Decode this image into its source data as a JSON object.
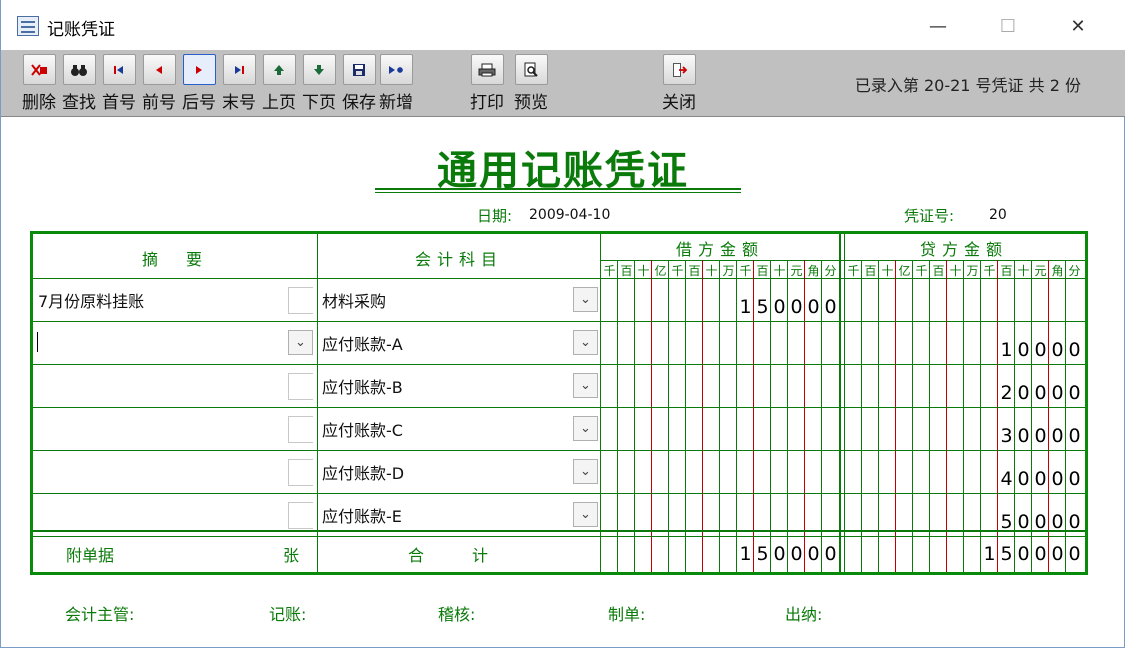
{
  "window": {
    "title": "记账凭证",
    "minimize": "—",
    "maximize": "☐",
    "close": "✕"
  },
  "toolbar": {
    "buttons": [
      {
        "label": "删除",
        "icon": "delete-icon"
      },
      {
        "label": "查找",
        "icon": "binoculars-icon"
      },
      {
        "label": "首号",
        "icon": "first-icon"
      },
      {
        "label": "前号",
        "icon": "prev-icon"
      },
      {
        "label": "后号",
        "icon": "next-icon"
      },
      {
        "label": "末号",
        "icon": "last-icon"
      },
      {
        "label": "上页",
        "icon": "up-icon"
      },
      {
        "label": "下页",
        "icon": "down-icon"
      },
      {
        "label": "保存",
        "icon": "save-icon"
      },
      {
        "label": "新增",
        "icon": "new-icon"
      },
      {
        "label": "打印",
        "icon": "printer-icon"
      },
      {
        "label": "预览",
        "icon": "preview-icon"
      },
      {
        "label": "关闭",
        "icon": "exit-icon"
      }
    ],
    "status": "已录入第 20-21 号凭证 共 2 份"
  },
  "voucher": {
    "title": "通用记账凭证",
    "date_label": "日期:",
    "date": "2009-04-10",
    "number_label": "凭证号:",
    "number": "20",
    "headers": {
      "summary": "摘　要",
      "account": "会计科目",
      "debit": "借方金额",
      "credit": "贷方金额",
      "units": [
        "千",
        "百",
        "十",
        "亿",
        "千",
        "百",
        "十",
        "万",
        "千",
        "百",
        "十",
        "元",
        "角",
        "分"
      ]
    },
    "rows": [
      {
        "summary": "7月份原料挂账",
        "account": "材料采购",
        "debit": "150000",
        "credit": ""
      },
      {
        "summary": "",
        "account": "应付账款-A",
        "debit": "",
        "credit": "10000"
      },
      {
        "summary": "",
        "account": "应付账款-B",
        "debit": "",
        "credit": "20000"
      },
      {
        "summary": "",
        "account": "应付账款-C",
        "debit": "",
        "credit": "30000"
      },
      {
        "summary": "",
        "account": "应付账款-D",
        "debit": "",
        "credit": "40000"
      },
      {
        "summary": "",
        "account": "应付账款-E",
        "debit": "",
        "credit": "50000"
      }
    ],
    "totals": {
      "attachment_label": "附单据",
      "attachment_unit": "张",
      "total_label": "合　　　计",
      "debit": "150000",
      "credit": "150000"
    }
  },
  "footer": {
    "supervisor": "会计主管:",
    "bookkeeper": "记账:",
    "auditor": "稽核:",
    "preparer": "制单:",
    "cashier": "出纳:"
  },
  "colors": {
    "accent": "#0a7a0a",
    "red_line": "#c00000",
    "toolbar": "#c0c0c0"
  }
}
